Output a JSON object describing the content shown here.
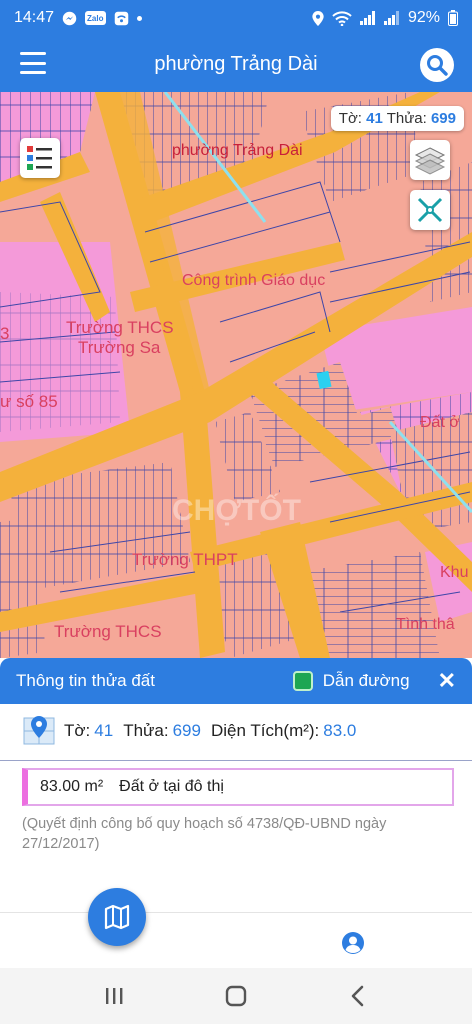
{
  "status_bar": {
    "time": "14:47",
    "app_icons": [
      "messenger-icon",
      "zalo-icon",
      "wifi-app-icon"
    ],
    "zalo_label": "Zalo",
    "battery": "92%"
  },
  "app_bar": {
    "title": "phường Trảng Dài"
  },
  "map": {
    "parcel_badge": {
      "sheet_label": "Tờ:",
      "sheet_value": "41",
      "parcel_label": "Thửa:",
      "parcel_value": "699"
    },
    "labels": {
      "ward": "phường Trảng Dài",
      "education": "Công trình Giáo dục",
      "school1_line1": "Trường THCS",
      "school1_line2": "Trường Sa",
      "no85": "ư số 85",
      "school_thpt": "Trường THPT",
      "school2": "Trường THCS",
      "tinh": "Tình thâ",
      "dat": "Đất ở",
      "khu": "Khu",
      "no3": "3",
      "watermark": "CHỢTỐT"
    },
    "colors": {
      "residential": "#f5a898",
      "road": "#f4b13c",
      "education": "#f49ad9",
      "selected": "#2bd0f0"
    }
  },
  "panel": {
    "title": "Thông tin thửa đất",
    "route_label": "Dẫn đường",
    "sheet_label": "Tờ:",
    "sheet_value": "41",
    "parcel_label": "Thửa:",
    "parcel_value": "699",
    "area_label": "Diện Tích(m²):",
    "area_value": "83.0",
    "landuse_area": "83.00 m²",
    "landuse_type": "Đất ở tại đô thị",
    "decision_text": "(Quyết định công bố quy hoạch số 4738/QĐ-UBND ngày 27/12/2017)"
  }
}
